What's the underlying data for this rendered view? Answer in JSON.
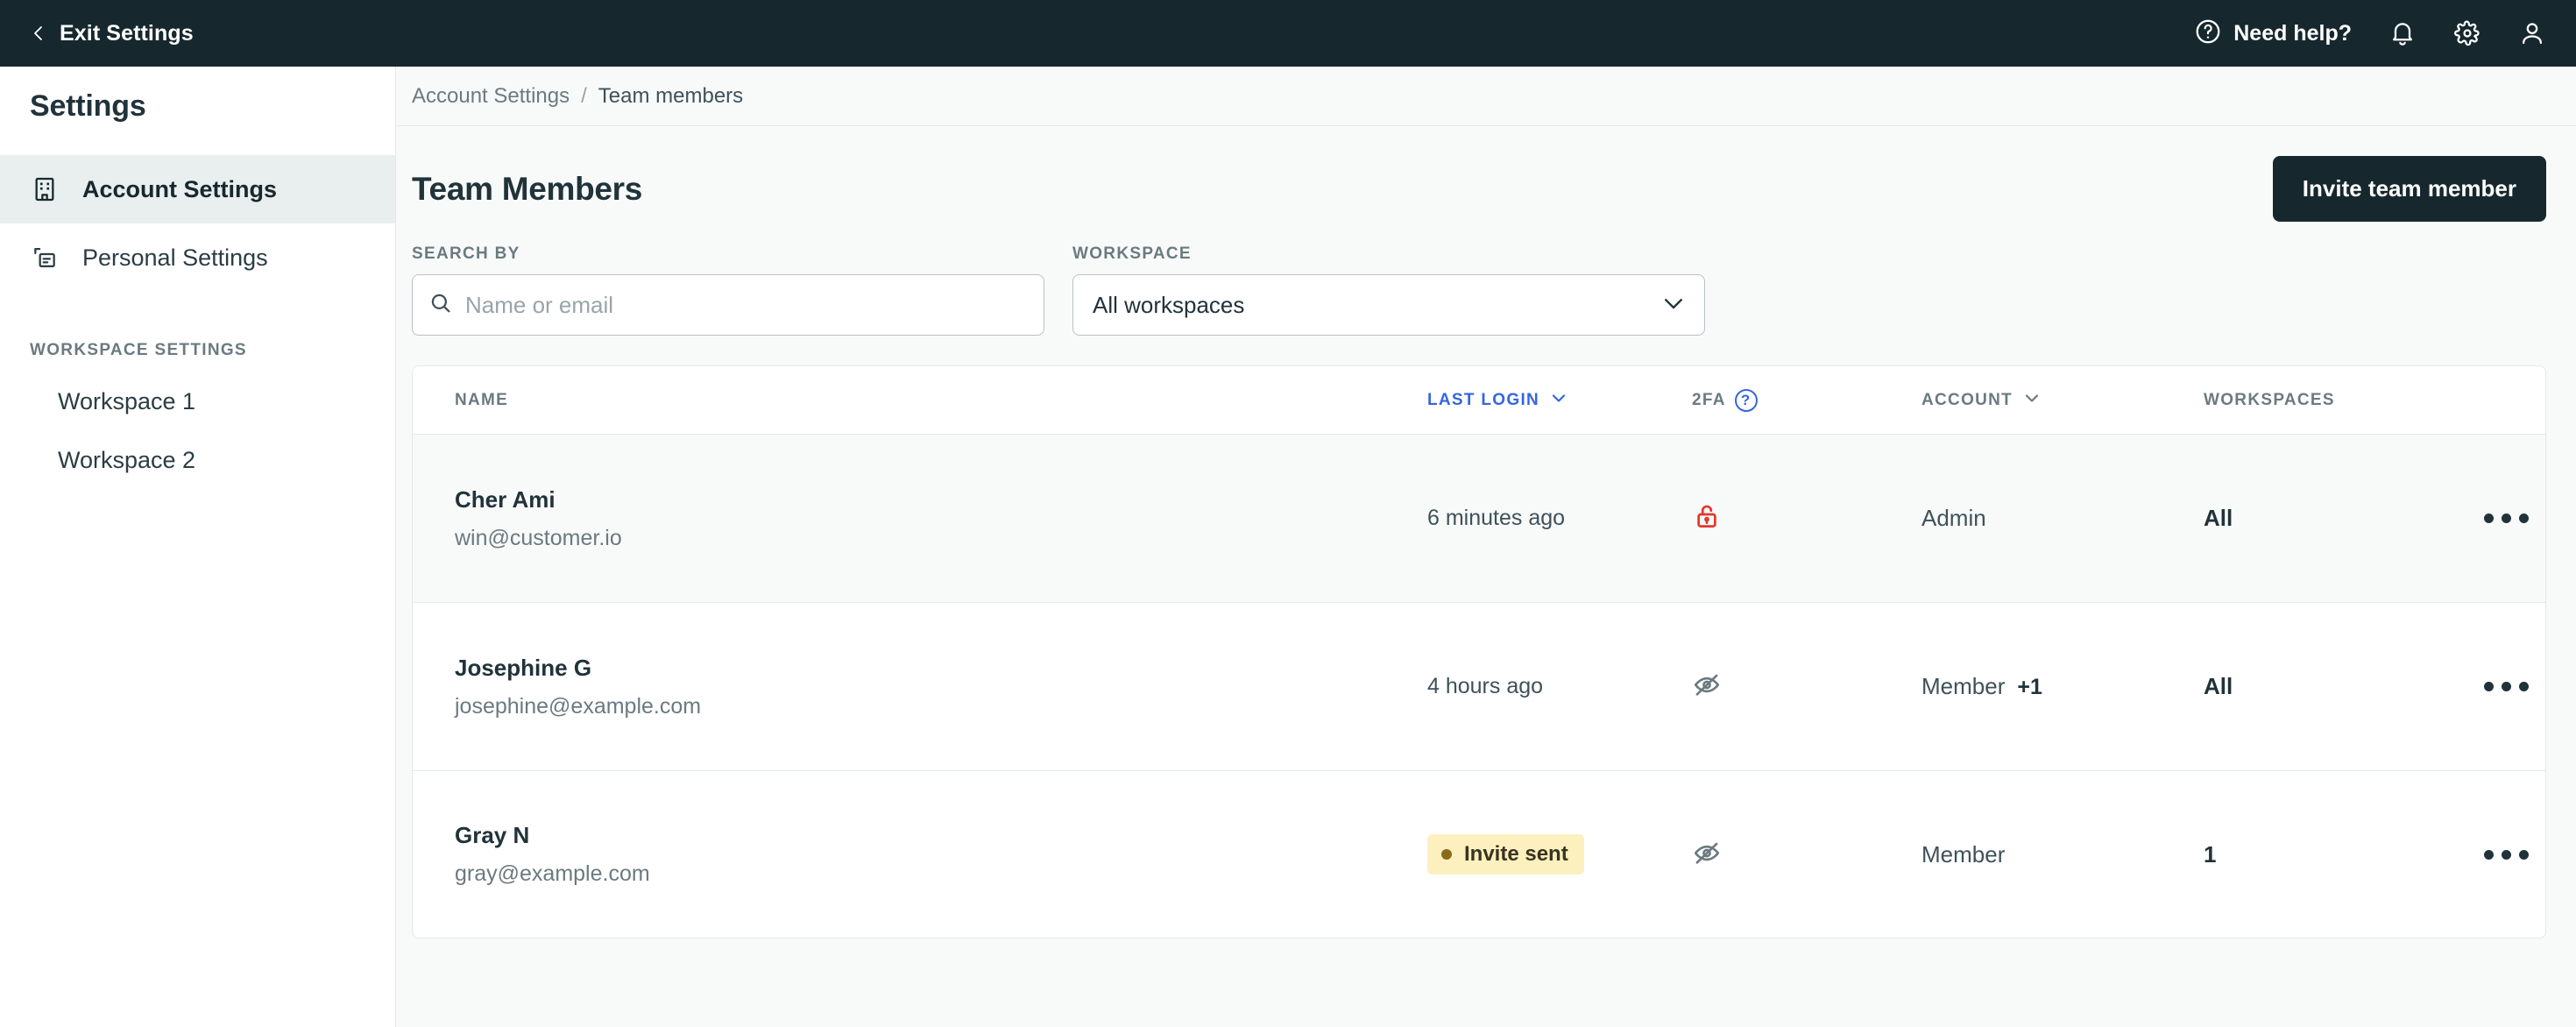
{
  "topbar": {
    "exit_label": "Exit Settings",
    "back_icon": "chevron-left-icon",
    "need_help_label": "Need help?",
    "help_icon": "question-circle-icon",
    "bell_icon": "bell-icon",
    "gear_icon": "gear-icon",
    "account_icon": "user-icon",
    "bg_color": "#16282D"
  },
  "sidebar": {
    "title": "Settings",
    "items": [
      {
        "label": "Account Settings",
        "icon": "building-icon",
        "active": true
      },
      {
        "label": "Personal Settings",
        "icon": "cards-icon",
        "active": false
      }
    ],
    "section_label": "WORKSPACE SETTINGS",
    "workspaces": [
      {
        "label": "Workspace 1"
      },
      {
        "label": "Workspace 2"
      }
    ]
  },
  "breadcrumb": {
    "parent": "Account Settings",
    "separator": "/",
    "current": "Team members"
  },
  "page": {
    "title": "Team Members",
    "invite_button": "Invite team member"
  },
  "filters": {
    "search": {
      "label": "SEARCH BY",
      "placeholder": "Name or email",
      "value": "",
      "icon": "search-icon"
    },
    "workspace": {
      "label": "WORKSPACE",
      "selected": "All workspaces",
      "options": [
        "All workspaces",
        "Workspace 1",
        "Workspace 2"
      ],
      "icon": "chevron-down-icon"
    }
  },
  "table": {
    "columns": [
      {
        "key": "name",
        "label": "NAME",
        "sortable": false,
        "active": false
      },
      {
        "key": "last_login",
        "label": "LAST LOGIN",
        "sortable": true,
        "active": true,
        "sort_icon": "chevron-down-icon"
      },
      {
        "key": "twofa",
        "label": "2FA",
        "sortable": false,
        "active": false,
        "help_icon": "question-circle-icon"
      },
      {
        "key": "account",
        "label": "ACCOUNT",
        "sortable": true,
        "active": false,
        "sort_icon": "chevron-down-icon"
      },
      {
        "key": "workspaces",
        "label": "WORKSPACES",
        "sortable": false,
        "active": false
      }
    ],
    "accent_color": "#3566E0",
    "rows": [
      {
        "name": "Cher Ami",
        "email": "win@customer.io",
        "last_login_text": "6 minutes ago",
        "last_login_badge": null,
        "twofa_icon": "unlock-icon",
        "twofa_color": "#E0382E",
        "account": "Admin",
        "account_extra": "",
        "workspaces": "All",
        "actions_icon": "kebab-menu-icon",
        "hovered": true
      },
      {
        "name": "Josephine G",
        "email": "josephine@example.com",
        "last_login_text": "4 hours ago",
        "last_login_badge": null,
        "twofa_icon": "eye-off-icon",
        "twofa_color": "#6B7A80",
        "account": "Member",
        "account_extra": "+1",
        "workspaces": "All",
        "actions_icon": "kebab-menu-icon",
        "hovered": false
      },
      {
        "name": "Gray N",
        "email": "gray@example.com",
        "last_login_text": "",
        "last_login_badge": "Invite sent",
        "twofa_icon": "eye-off-icon",
        "twofa_color": "#6B7A80",
        "account": "Member",
        "account_extra": "",
        "workspaces": "1",
        "actions_icon": "kebab-menu-icon",
        "hovered": false
      }
    ]
  }
}
